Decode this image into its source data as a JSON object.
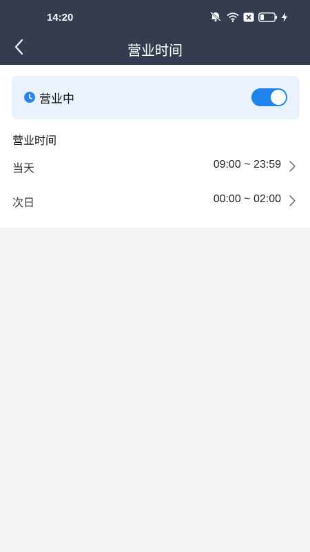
{
  "status_bar": {
    "time": "14:20",
    "icons": [
      "mute-bell-icon",
      "wifi-icon",
      "sim-off-icon",
      "battery-icon",
      "charging-icon"
    ]
  },
  "nav": {
    "title": "营业时间",
    "back_icon": "chevron-left-icon"
  },
  "status_card": {
    "label": "营业中",
    "icon": "clock-icon",
    "toggle_on": true,
    "accent_color": "#1f83ea",
    "background_color": "#eaf2fd"
  },
  "hours": {
    "section_title": "营业时间",
    "rows": [
      {
        "label": "当天",
        "value": "09:00 ~ 23:59"
      },
      {
        "label": "次日",
        "value": "00:00 ~ 02:00"
      }
    ]
  },
  "colors": {
    "header_bg": "#343d4f",
    "page_bg": "#f3f3f3"
  }
}
